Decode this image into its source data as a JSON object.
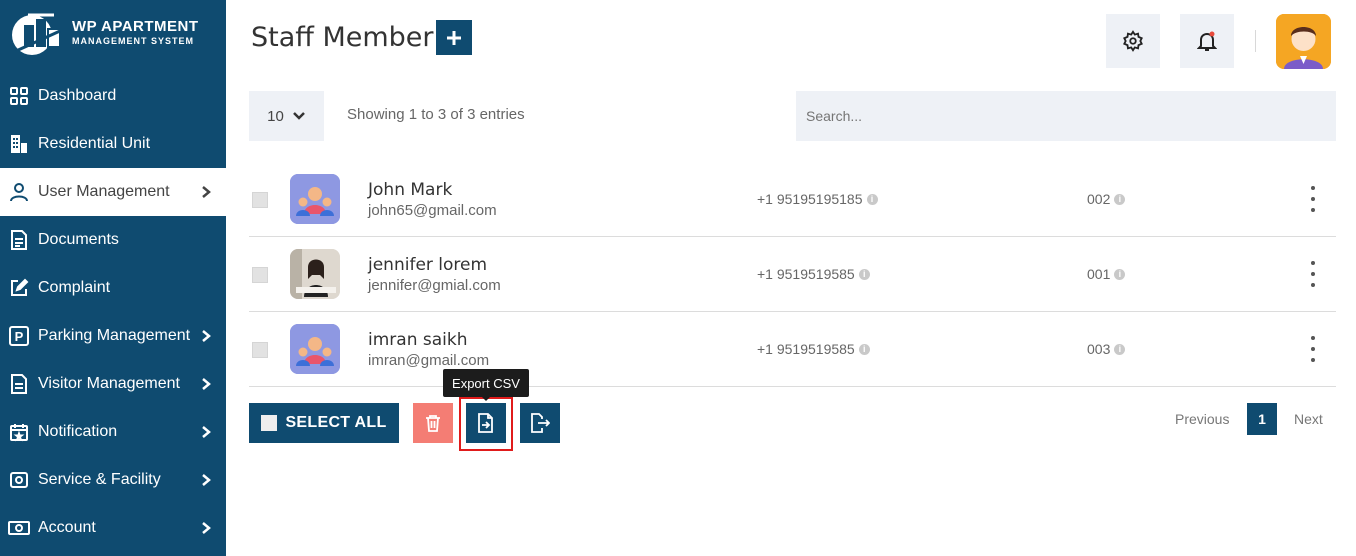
{
  "brand": {
    "title": "WP APARTMENT",
    "subtitle": "MANAGEMENT SYSTEM"
  },
  "sidebar": {
    "items": [
      {
        "label": "Dashboard",
        "icon": "grid-icon",
        "chevron": false,
        "active": false
      },
      {
        "label": "Residential Unit",
        "icon": "building-icon",
        "chevron": false,
        "active": false
      },
      {
        "label": "User Management",
        "icon": "user-icon",
        "chevron": true,
        "active": true
      },
      {
        "label": "Documents",
        "icon": "document-icon",
        "chevron": false,
        "active": false
      },
      {
        "label": "Complaint",
        "icon": "edit-icon",
        "chevron": false,
        "active": false
      },
      {
        "label": "Parking Management",
        "icon": "parking-icon",
        "chevron": true,
        "active": false
      },
      {
        "label": "Visitor Management",
        "icon": "visitor-document-icon",
        "chevron": true,
        "active": false
      },
      {
        "label": "Notification",
        "icon": "calendar-star-icon",
        "chevron": true,
        "active": false
      },
      {
        "label": "Service & Facility",
        "icon": "service-icon",
        "chevron": true,
        "active": false
      },
      {
        "label": "Account",
        "icon": "money-icon",
        "chevron": true,
        "active": false
      }
    ]
  },
  "header": {
    "title": "Staff Member",
    "add_label": "+"
  },
  "table": {
    "page_length": "10",
    "info": "Showing 1 to 3 of 3 entries",
    "search_placeholder": "Search...",
    "rows": [
      {
        "name": "John Mark",
        "email": "john65@gmail.com",
        "phone": "+1 95195195185",
        "code": "002"
      },
      {
        "name": "jennifer lorem",
        "email": "jennifer@gmial.com",
        "phone": "+1 9519519585",
        "code": "001"
      },
      {
        "name": "imran saikh",
        "email": "imran@gmail.com",
        "phone": "+1 9519519585",
        "code": "003"
      }
    ]
  },
  "actions": {
    "select_all": "SELECT ALL",
    "tooltip": "Export CSV"
  },
  "pagination": {
    "previous": "Previous",
    "current": "1",
    "next": "Next"
  },
  "colors": {
    "primary": "#0f4b70",
    "danger": "#f47d74",
    "highlight": "#e01b1b"
  }
}
